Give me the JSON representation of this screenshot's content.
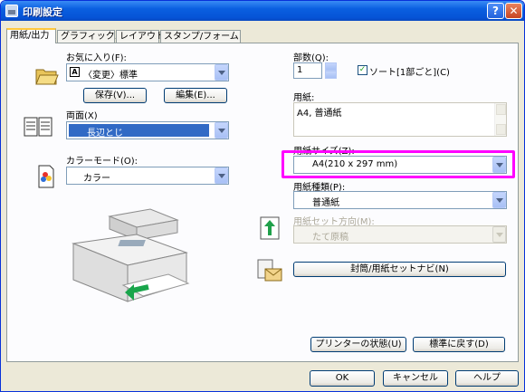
{
  "window": {
    "title": "印刷設定"
  },
  "tabs": [
    "用紙/出力",
    "グラフィックス",
    "レイアウト",
    "スタンプ/フォーム"
  ],
  "favorites": {
    "label": "お気に入り(F):",
    "value": "〈変更〉標準",
    "save": "保存(V)...",
    "edit": "編集(E)..."
  },
  "duplex": {
    "label": "両面(X)",
    "value": "長辺とじ"
  },
  "color_mode": {
    "label": "カラーモード(O):",
    "value": "カラー"
  },
  "copies": {
    "label": "部数(Q):",
    "value": "1",
    "collate": "ソート[1部ごと](C)",
    "collate_checked": "✓"
  },
  "paper": {
    "label": "用紙:",
    "value": "A4, 普通紙"
  },
  "paper_size": {
    "label": "用紙サイズ(Z):",
    "value": "A4(210 x 297 mm)"
  },
  "paper_type": {
    "label": "用紙種類(P):",
    "value": "普通紙"
  },
  "paper_orientation": {
    "label": "用紙セット方向(M):",
    "value": "たて原稿"
  },
  "envelope_button": "封筒/用紙セットナビ(N)",
  "printer_status_button": "プリンターの状態(U)",
  "restore_defaults_button": "標準に戻す(D)",
  "footer": {
    "ok": "OK",
    "cancel": "キャンセル",
    "help": "ヘルプ"
  },
  "title_buttons": {
    "help": "?",
    "close": "✕"
  }
}
